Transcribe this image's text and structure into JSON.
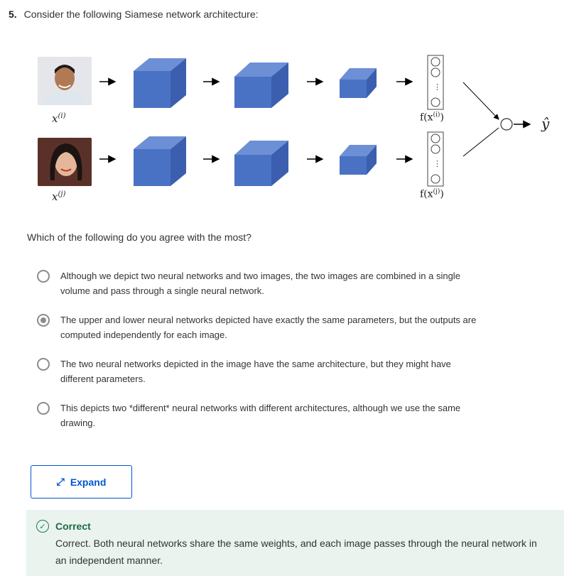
{
  "question": {
    "number": "5.",
    "text": "Consider the following Siamese network architecture:"
  },
  "diagram": {
    "x_i": "x",
    "x_i_sup": "(i)",
    "x_j": "x",
    "x_j_sup": "(j)",
    "f_i": "f(x",
    "f_i_sup": "(i)",
    "f_i_close": ")",
    "f_j": "f(x",
    "f_j_sup": "(j)",
    "f_j_close": ")",
    "yhat": "ŷ",
    "cube_color": "#4a72c4"
  },
  "prompt": "Which of the following do you agree with the most?",
  "options": [
    {
      "label": "Although we depict two neural networks and two images, the two images are combined in a single volume and pass through a single neural network.",
      "selected": false
    },
    {
      "label": "The upper and lower neural networks depicted have exactly the same parameters, but the outputs are computed independently for each image.",
      "selected": true
    },
    {
      "label": "The two neural networks depicted in the image have the same architecture, but they might have different parameters.",
      "selected": false
    },
    {
      "label": "This depicts two *different* neural networks with different architectures, although we use the same drawing.",
      "selected": false
    }
  ],
  "expand_label": "Expand",
  "feedback": {
    "title": "Correct",
    "body": "Correct. Both neural networks share the same weights, and each image passes through the neural network in an independent manner.",
    "color": "#1d7c50"
  }
}
